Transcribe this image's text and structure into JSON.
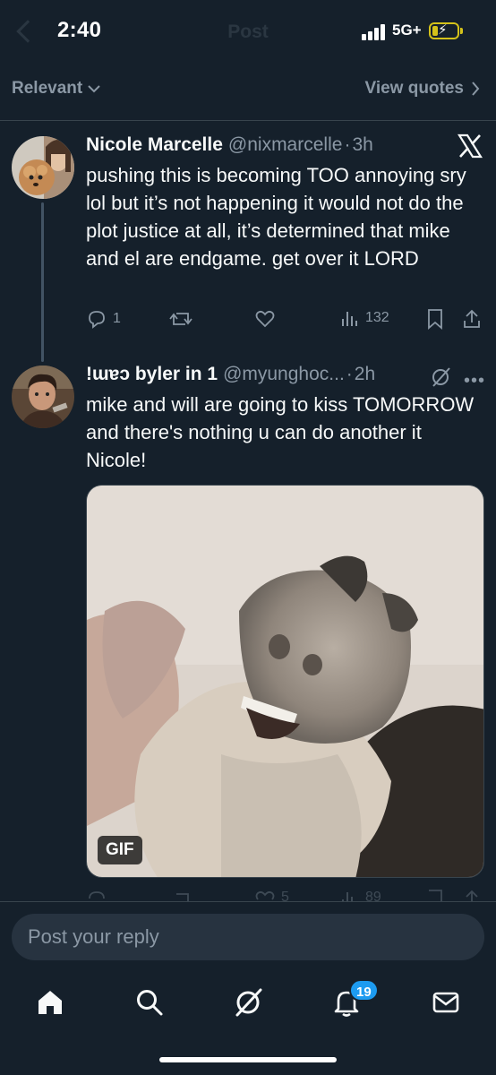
{
  "status_bar": {
    "time": "2:40",
    "network": "5G+",
    "header_ghost_title": "Post"
  },
  "filter": {
    "sort_label": "Relevant",
    "view_quotes_label": "View quotes"
  },
  "tweets": [
    {
      "display_name": "Nicole Marcelle",
      "handle": "@nixmarcelle",
      "separator": "·",
      "age": "3h",
      "text": "pushing this is becoming TOO annoying sry lol but it’s not happening it would not do the plot justice at all, it’s determined that mike and el are endgame. get over it LORD",
      "replies": "1",
      "views": "132"
    },
    {
      "display_name": "!ɯɐɔ byler in 1",
      "handle": "@myunghoc...",
      "separator": "·",
      "age": "2h",
      "text": "mike and will are going to kiss TOMORROW and there's nothing u can do another it Nicole!",
      "media_badge": "GIF",
      "likes": "5",
      "views": "89"
    }
  ],
  "reply": {
    "placeholder": "Post your reply"
  },
  "nav": {
    "notifications_badge": "19"
  },
  "icons": [
    "reply-icon",
    "retweet-icon",
    "like-icon",
    "views-icon",
    "bookmark-icon",
    "share-icon",
    "x-logo-icon",
    "grok-icon",
    "more-icon",
    "home-icon",
    "search-icon",
    "notifications-icon",
    "messages-icon"
  ],
  "colors": {
    "background": "#15202b",
    "text": "#f7f9f9",
    "muted": "#8b98a5",
    "accent": "#1d9bf0",
    "input_bg": "#273340"
  }
}
